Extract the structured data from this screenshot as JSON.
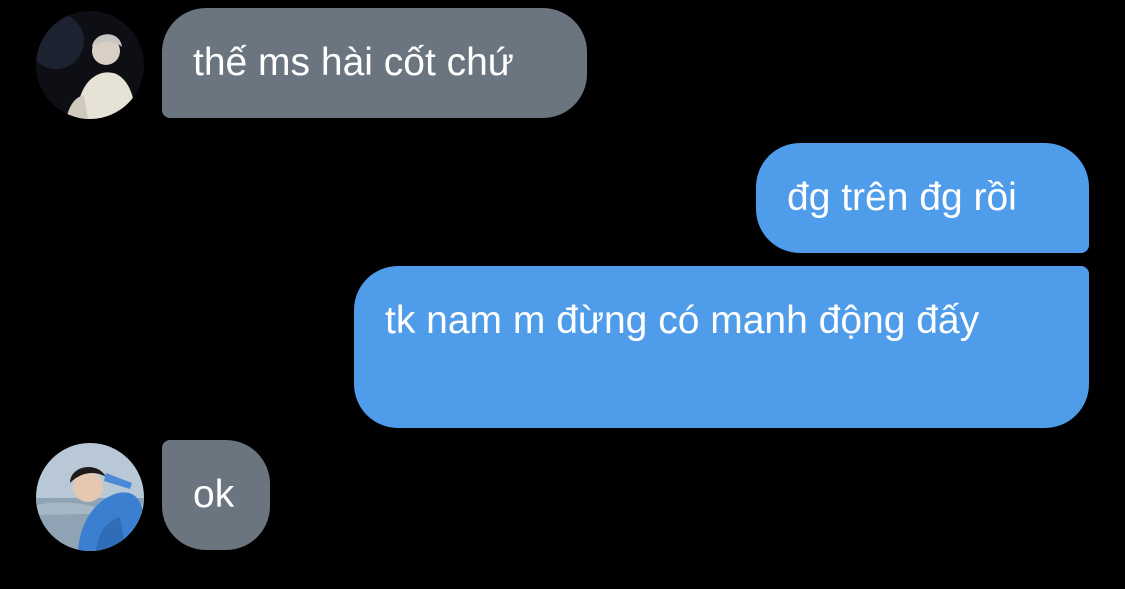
{
  "messages": [
    {
      "sender": "them",
      "text": "thế ms hài cốt chứ"
    },
    {
      "sender": "me",
      "text": "đg trên đg rồi"
    },
    {
      "sender": "me",
      "text": "tk nam m đừng có manh động đấy"
    },
    {
      "sender": "them",
      "text": "ok"
    }
  ],
  "colors": {
    "background": "#000000",
    "incoming_bubble": "#6b7580",
    "outgoing_bubble": "#4f9cea",
    "text": "#ffffff"
  },
  "avatars": [
    {
      "icon": "contact-avatar-photo"
    },
    {
      "icon": "contact-avatar-photo"
    }
  ]
}
